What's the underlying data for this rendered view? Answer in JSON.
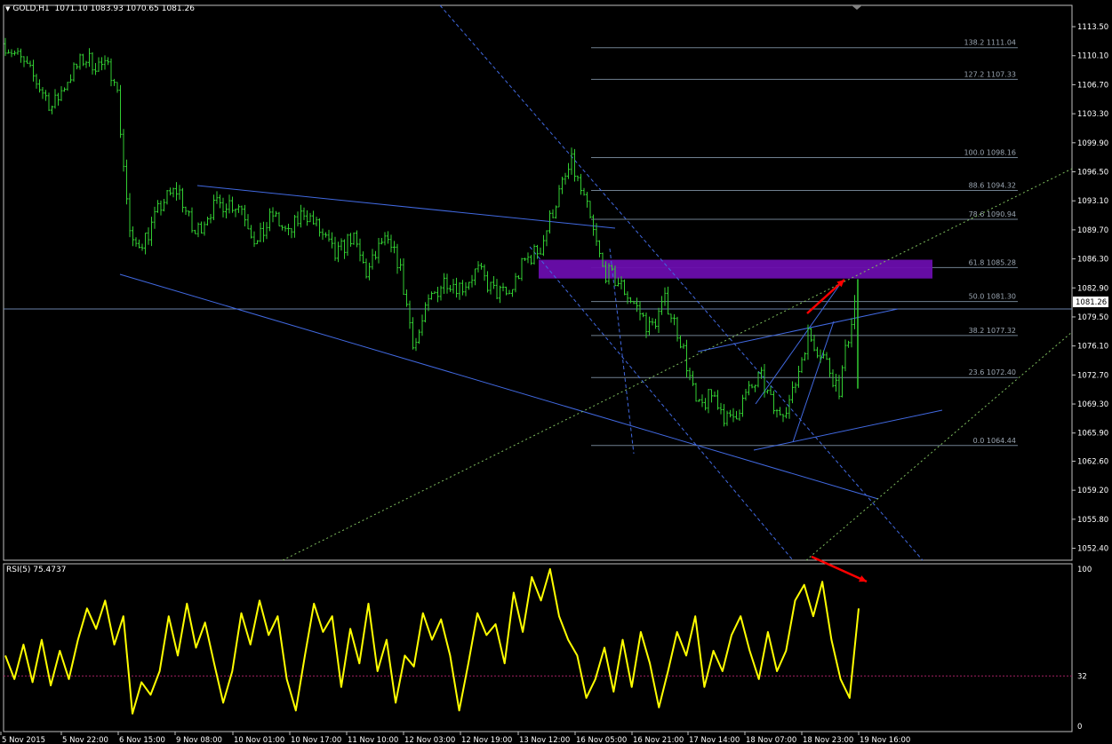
{
  "header": {
    "symbol": "GOLD,H1",
    "ohlc": "1071.10 1083.93 1070.65 1081.26"
  },
  "rsi": {
    "label": "RSI(5) 75.4737",
    "levels": [
      100,
      32,
      0
    ],
    "level_labels": [
      "100",
      "32",
      "0"
    ]
  },
  "colors": {
    "background": "#000000",
    "candles": "#32cd32",
    "trendlines": "#4169e1",
    "fib": "#708090",
    "zone": "#6a0dad",
    "rsi": "#ffff00",
    "arrows": "#ff0000",
    "price_tag_bg": "#ffffff"
  },
  "chart_data": [
    {
      "type": "line",
      "subtype": "candlestick",
      "symbol": "GOLD,H1",
      "x_tick_labels": [
        "5 Nov 2015",
        "5 Nov 22:00",
        "6 Nov 15:00",
        "9 Nov 08:00",
        "10 Nov 01:00",
        "10 Nov 17:00",
        "11 Nov 10:00",
        "12 Nov 03:00",
        "12 Nov 19:00",
        "13 Nov 12:00",
        "16 Nov 05:00",
        "16 Nov 21:00",
        "17 Nov 14:00",
        "18 Nov 07:00",
        "18 Nov 23:00",
        "19 Nov 16:00"
      ],
      "y_tick_labels": [
        "1113.50",
        "1110.10",
        "1106.70",
        "1103.30",
        "1099.90",
        "1096.50",
        "1093.10",
        "1089.70",
        "1086.30",
        "1082.90",
        "1079.50",
        "1076.10",
        "1072.70",
        "1069.30",
        "1065.90",
        "1062.60",
        "1059.20",
        "1055.80",
        "1052.40"
      ],
      "ylim": [
        1051.0,
        1116.0
      ],
      "current_price": "1081.26",
      "price_path": [
        1111.5,
        1109.5,
        1107.0,
        1104.0,
        1107.5,
        1109.8,
        1109.0,
        1108.0,
        1087.5,
        1089.0,
        1093.0,
        1094.5,
        1089.0,
        1092.0,
        1093.0,
        1092.5,
        1088.0,
        1091.5,
        1089.0,
        1092.0,
        1089.5,
        1086.5,
        1089.0,
        1084.5,
        1088.5,
        1086.0,
        1076.0,
        1081.5,
        1084.0,
        1083.0,
        1085.0,
        1082.5,
        1082.0,
        1086.0,
        1087.5,
        1093.0,
        1097.5,
        1092.0,
        1085.0,
        1083.5,
        1081.0,
        1078.0,
        1081.5,
        1076.5,
        1068.5,
        1070.5,
        1067.0,
        1070.0,
        1072.5,
        1068.0,
        1070.0,
        1077.5,
        1075.0,
        1071.0,
        1081.3
      ],
      "fibonacci": [
        {
          "level": "138.2",
          "price": "1111.04"
        },
        {
          "level": "127.2",
          "price": "1107.33"
        },
        {
          "level": "100.0",
          "price": "1098.16"
        },
        {
          "level": "88.6",
          "price": "1094.32"
        },
        {
          "level": "78.6",
          "price": "1090.94"
        },
        {
          "level": "61.8",
          "price": "1085.28"
        },
        {
          "level": "50.0",
          "price": "1081.30"
        },
        {
          "level": "38.2",
          "price": "1077.32"
        },
        {
          "level": "23.6",
          "price": "1072.40"
        },
        {
          "level": "0.0",
          "price": "1064.44"
        }
      ],
      "zone": {
        "from": 1084.0,
        "to": 1086.2
      }
    },
    {
      "type": "line",
      "name": "RSI(5)",
      "last_value": 75.4737,
      "ylim": [
        0,
        100
      ],
      "levels": [
        32
      ],
      "values": [
        45,
        30,
        52,
        28,
        55,
        26,
        48,
        30,
        55,
        75,
        62,
        80,
        52,
        70,
        8,
        28,
        20,
        35,
        70,
        45,
        78,
        50,
        66,
        40,
        15,
        35,
        72,
        52,
        80,
        58,
        70,
        30,
        10,
        45,
        78,
        60,
        70,
        25,
        62,
        40,
        78,
        35,
        55,
        15,
        45,
        38,
        72,
        55,
        68,
        45,
        10,
        40,
        72,
        58,
        65,
        40,
        85,
        60,
        95,
        80,
        100,
        70,
        55,
        45,
        18,
        30,
        50,
        22,
        55,
        25,
        60,
        40,
        12,
        35,
        60,
        45,
        70,
        25,
        48,
        35,
        58,
        70,
        48,
        30,
        60,
        35,
        48,
        80,
        90,
        70,
        92,
        55,
        30,
        18,
        75
      ]
    }
  ]
}
